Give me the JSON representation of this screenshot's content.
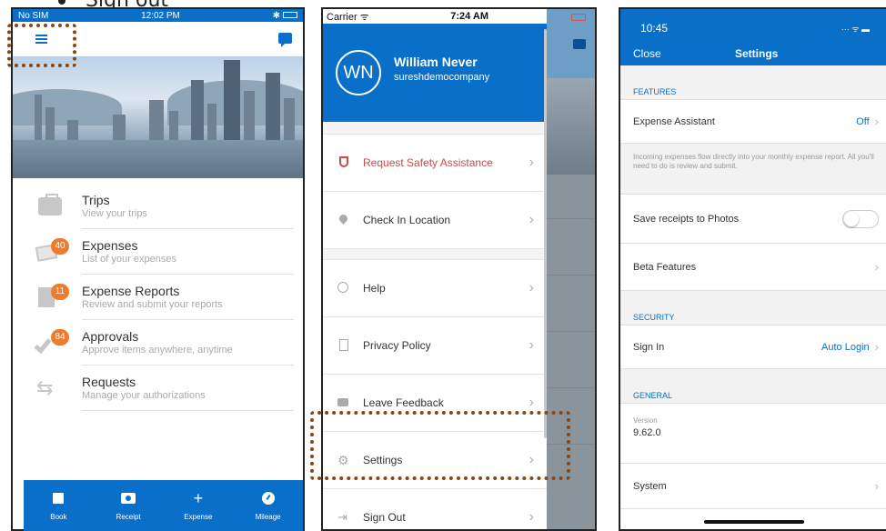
{
  "heading": {
    "text": "Sign out"
  },
  "phone1": {
    "status": {
      "carrier": "No SIM",
      "time": "12:02 PM"
    },
    "menu": [
      {
        "title": "Trips",
        "subtitle": "View your trips",
        "badge": ""
      },
      {
        "title": "Expenses",
        "subtitle": "List of your expenses",
        "badge": "40"
      },
      {
        "title": "Expense Reports",
        "subtitle": "Review and submit your reports",
        "badge": "11"
      },
      {
        "title": "Approvals",
        "subtitle": "Approve items anywhere, anytime",
        "badge": "84"
      },
      {
        "title": "Requests",
        "subtitle": "Manage your authorizations",
        "badge": ""
      }
    ],
    "tabs": [
      "Book",
      "Receipt",
      "Expense",
      "Mileage"
    ]
  },
  "phone2": {
    "status": {
      "carrier": "Carrier",
      "time": "7:24 AM"
    },
    "profile": {
      "initials": "WN",
      "name": "William Never",
      "company": "sureshdemocompany"
    },
    "items": [
      "Request Safety Assistance",
      "Check In Location",
      "Help",
      "Privacy Policy",
      "Leave Feedback",
      "Settings",
      "Sign Out"
    ]
  },
  "phone3": {
    "status": {
      "time": "10:45"
    },
    "header": {
      "close": "Close",
      "title": "Settings"
    },
    "features": {
      "header": "FEATURES",
      "expense_assistant": {
        "label": "Expense Assistant",
        "value": "Off"
      },
      "description": "Incoming expenses flow directly into your monthly expense report. All you'll need to do is review and submit.",
      "save_receipts": {
        "label": "Save receipts to Photos",
        "on": false
      },
      "beta": {
        "label": "Beta Features"
      }
    },
    "security": {
      "header": "SECURITY",
      "sign_in": {
        "label": "Sign In",
        "value": "Auto Login"
      }
    },
    "general": {
      "header": "GENERAL",
      "version_label": "Version",
      "version_value": "9.62.0",
      "system": {
        "label": "System"
      }
    }
  },
  "colors": {
    "accent": "#0a6fc8",
    "badge": "#f07b2a",
    "alert": "#c94a4a",
    "highlight_border": "#8b4513"
  }
}
